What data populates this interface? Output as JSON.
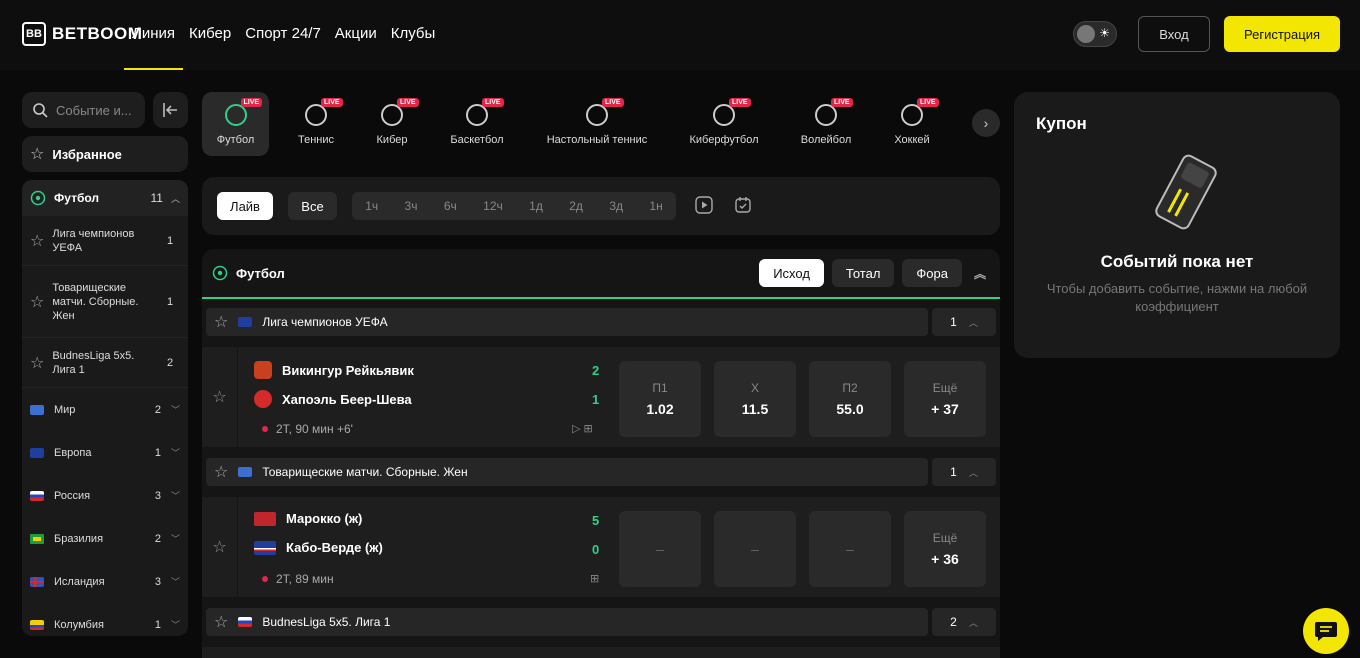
{
  "brand": {
    "logo_mark": "BB",
    "name": "BETBOOM"
  },
  "nav": [
    "Линия",
    "Кибер",
    "Спорт 24/7",
    "Акции",
    "Клубы"
  ],
  "header": {
    "login": "Вход",
    "register": "Регистрация",
    "theme_icon": "sun-icon"
  },
  "sidebar": {
    "search_placeholder": "Событие и...",
    "favorites": "Избранное",
    "sport": {
      "name": "Футбол",
      "count": "11"
    },
    "leagues": [
      {
        "name": "Лига чемпионов УЕФА",
        "count": "1"
      },
      {
        "name": "Товарищеские матчи. Сборные. Жен",
        "count": "1"
      },
      {
        "name": "BudnesLiga 5x5. Лига 1",
        "count": "2"
      }
    ],
    "countries": [
      {
        "name": "Мир",
        "count": "2"
      },
      {
        "name": "Европа",
        "count": "1"
      },
      {
        "name": "Россия",
        "count": "3"
      },
      {
        "name": "Бразилия",
        "count": "2"
      },
      {
        "name": "Исландия",
        "count": "3"
      },
      {
        "name": "Колумбия",
        "count": "1"
      }
    ]
  },
  "sports_tabs": [
    "Футбол",
    "Теннис",
    "Кибер",
    "Баскетбол",
    "Настольный теннис",
    "Киберфутбол",
    "Волейбол",
    "Хоккей"
  ],
  "live_badge": "LIVE",
  "filters": {
    "live": "Лайв",
    "all": "Все",
    "times": [
      "1ч",
      "3ч",
      "6ч",
      "12ч",
      "1д",
      "2д",
      "3д",
      "1н"
    ]
  },
  "events": {
    "sport": "Футбол",
    "tabs": [
      "Исход",
      "Тотал",
      "Фора"
    ],
    "groups": [
      {
        "league": "Лига чемпионов УЕФА",
        "count": "1",
        "match": {
          "team1": "Викингур Рейкьявик",
          "score1": "2",
          "team2": "Хапоэль Беер-Шева",
          "score2": "1",
          "time": "2Т, 90 мин +6'",
          "odds": [
            {
              "label": "П1",
              "value": "1.02"
            },
            {
              "label": "Х",
              "value": "11.5"
            },
            {
              "label": "П2",
              "value": "55.0"
            }
          ],
          "more_label": "Ещё",
          "more": "+ 37"
        }
      },
      {
        "league": "Товарищеские матчи. Сборные. Жен",
        "count": "1",
        "match": {
          "team1": "Марокко (ж)",
          "score1": "5",
          "team2": "Кабо-Верде (ж)",
          "score2": "0",
          "time": "2Т, 89 мин",
          "odds": [
            {
              "label": "",
              "value": "–"
            },
            {
              "label": "",
              "value": "–"
            },
            {
              "label": "",
              "value": "–"
            }
          ],
          "more_label": "Ещё",
          "more": "+ 36"
        }
      },
      {
        "league": "BudnesLiga 5x5. Лига 1",
        "count": "2"
      }
    ]
  },
  "coupon": {
    "title": "Купон",
    "empty": "Событий пока нет",
    "hint": "Чтобы добавить событие, нажми на любой коэффициент"
  },
  "colors": {
    "accent": "#f3e600",
    "live": "#e0284b",
    "score": "#2fd089"
  }
}
